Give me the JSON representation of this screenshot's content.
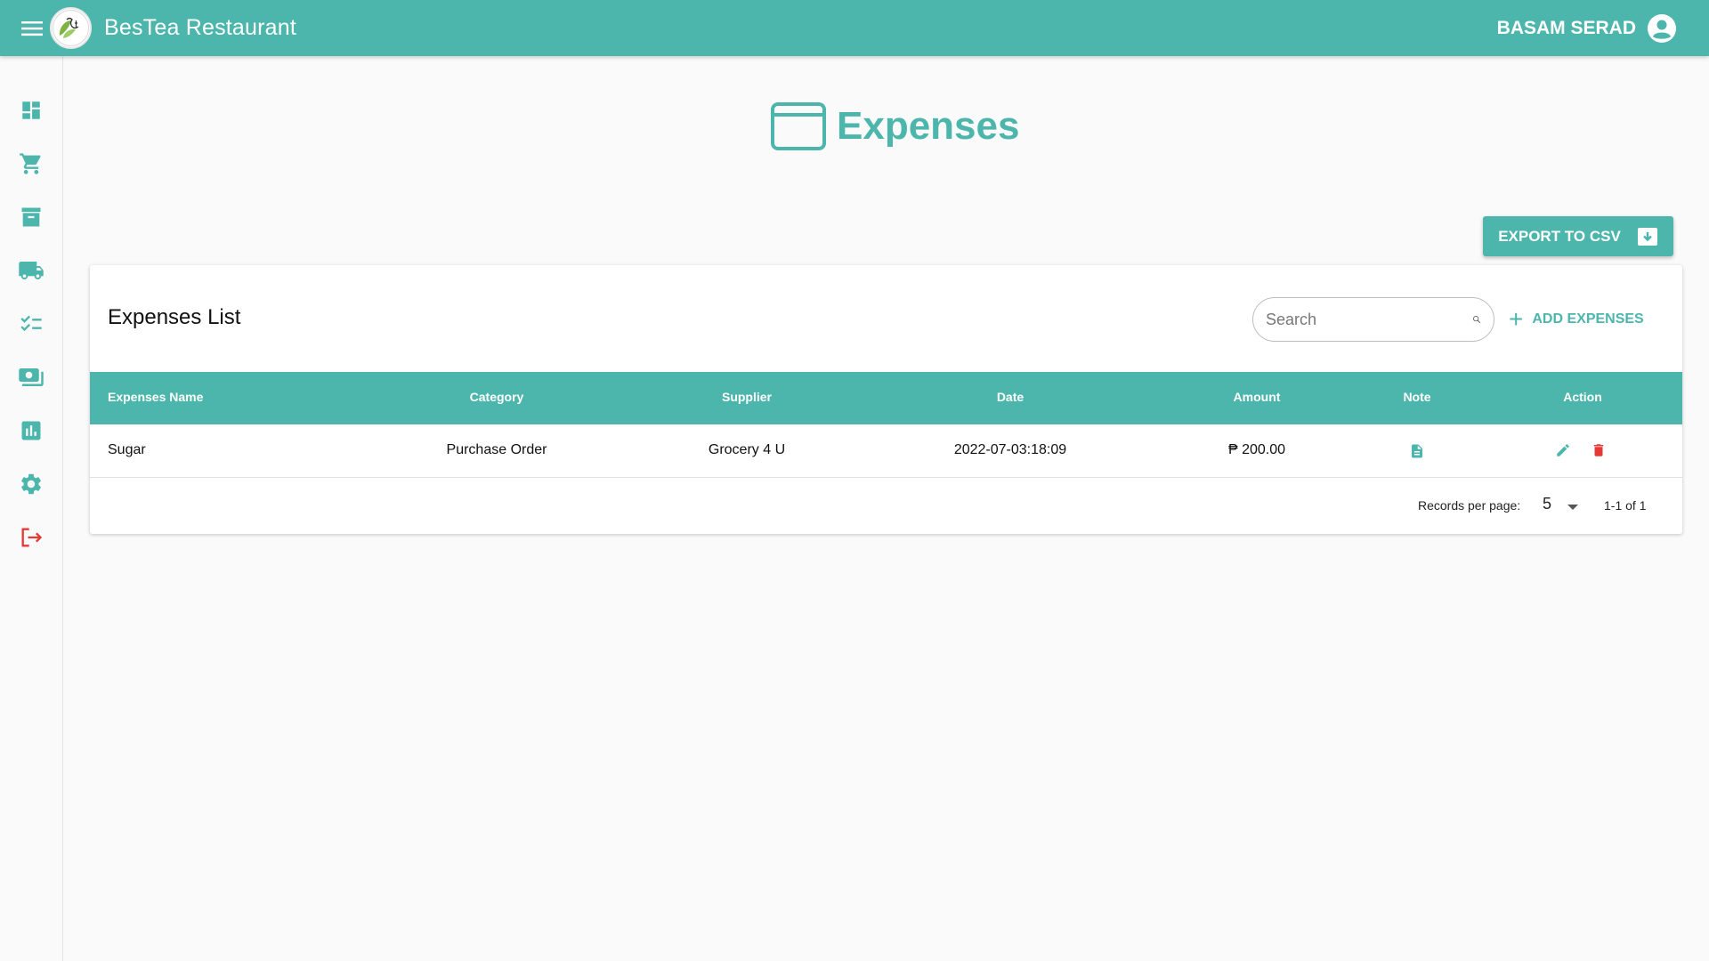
{
  "app": {
    "title": "BesTea Restaurant",
    "user_name": "BASAM SERAD",
    "colors": {
      "primary": "#4db6ac",
      "danger": "#e53935"
    }
  },
  "sidebar": {
    "items": [
      {
        "icon": "dashboard-icon"
      },
      {
        "icon": "cart-icon"
      },
      {
        "icon": "archive-icon"
      },
      {
        "icon": "truck-icon"
      },
      {
        "icon": "checklist-icon"
      },
      {
        "icon": "payments-icon"
      },
      {
        "icon": "report-chart-icon"
      },
      {
        "icon": "settings-gear-icon"
      },
      {
        "icon": "logout-icon"
      }
    ]
  },
  "page": {
    "title": "Expenses",
    "export_label": "EXPORT TO CSV"
  },
  "card": {
    "title": "Expenses List",
    "search_placeholder": "Search",
    "add_label": "ADD EXPENSES"
  },
  "table": {
    "headers": [
      "Expenses Name",
      "Category",
      "Supplier",
      "Date",
      "Amount",
      "Note",
      "Action"
    ],
    "rows": [
      {
        "name": "Sugar",
        "category": "Purchase Order",
        "supplier": "Grocery 4 U",
        "date": "2022-07-03:18:09",
        "amount": "₱ 200.00"
      }
    ]
  },
  "pagination": {
    "records_label": "Records per page:",
    "per_page": "5",
    "range": "1-1 of 1"
  }
}
